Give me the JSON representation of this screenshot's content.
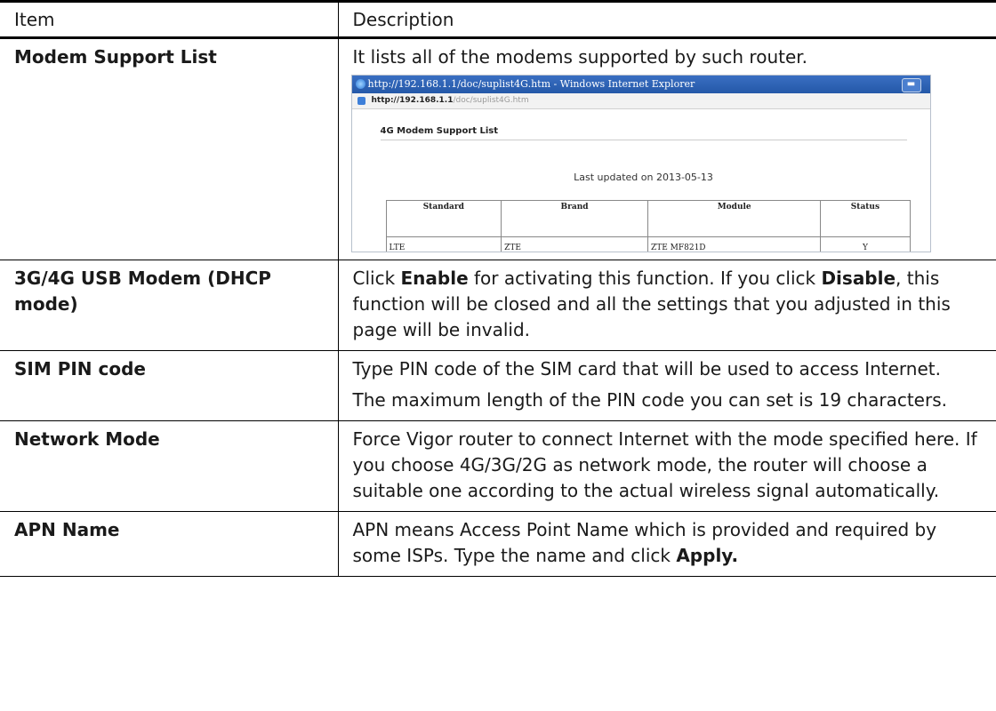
{
  "table": {
    "headers": [
      "Item",
      "Description"
    ],
    "rows": [
      {
        "item": "Modem Support List",
        "desc": "It lists all of the modems supported by such router."
      },
      {
        "item": "3G/4G USB Modem (DHCP mode)",
        "desc_parts": [
          "Click ",
          "Enable",
          " for activating this function. If you click ",
          "Disable",
          ", this function will be closed and all the settings that you adjusted in this page will be invalid."
        ]
      },
      {
        "item": "SIM PIN code",
        "desc": "Type PIN code of the SIM card that will be used to access Internet.",
        "desc2": "The maximum length of the PIN code you can set is 19 characters."
      },
      {
        "item": "Network Mode",
        "desc": "Force Vigor router to connect Internet with the mode specified here. If you choose 4G/3G/2G as network mode, the router will choose a suitable one according to the actual wireless signal automatically."
      },
      {
        "item": "APN Name",
        "desc_parts": [
          "APN means Access Point Name which is provided and required by some ISPs. Type the name and click ",
          "Apply."
        ]
      }
    ]
  },
  "screenshot": {
    "window_title": "http://192.168.1.1/doc/suplist4G.htm - Windows Internet Explorer",
    "address_host": "http://192.168.1.1",
    "address_path": "/doc/suplist4G.htm",
    "heading": "4G Modem Support List",
    "updated": "Last updated on 2013-05-13",
    "columns": [
      "Standard",
      "Brand",
      "Module",
      "Status"
    ],
    "rows": [
      {
        "standard": "LTE",
        "brand": "ZTE",
        "module": "ZTE MF821D",
        "status": "Y"
      }
    ]
  },
  "colors": {
    "titlebar": "#2458a8",
    "border": "#000000"
  }
}
